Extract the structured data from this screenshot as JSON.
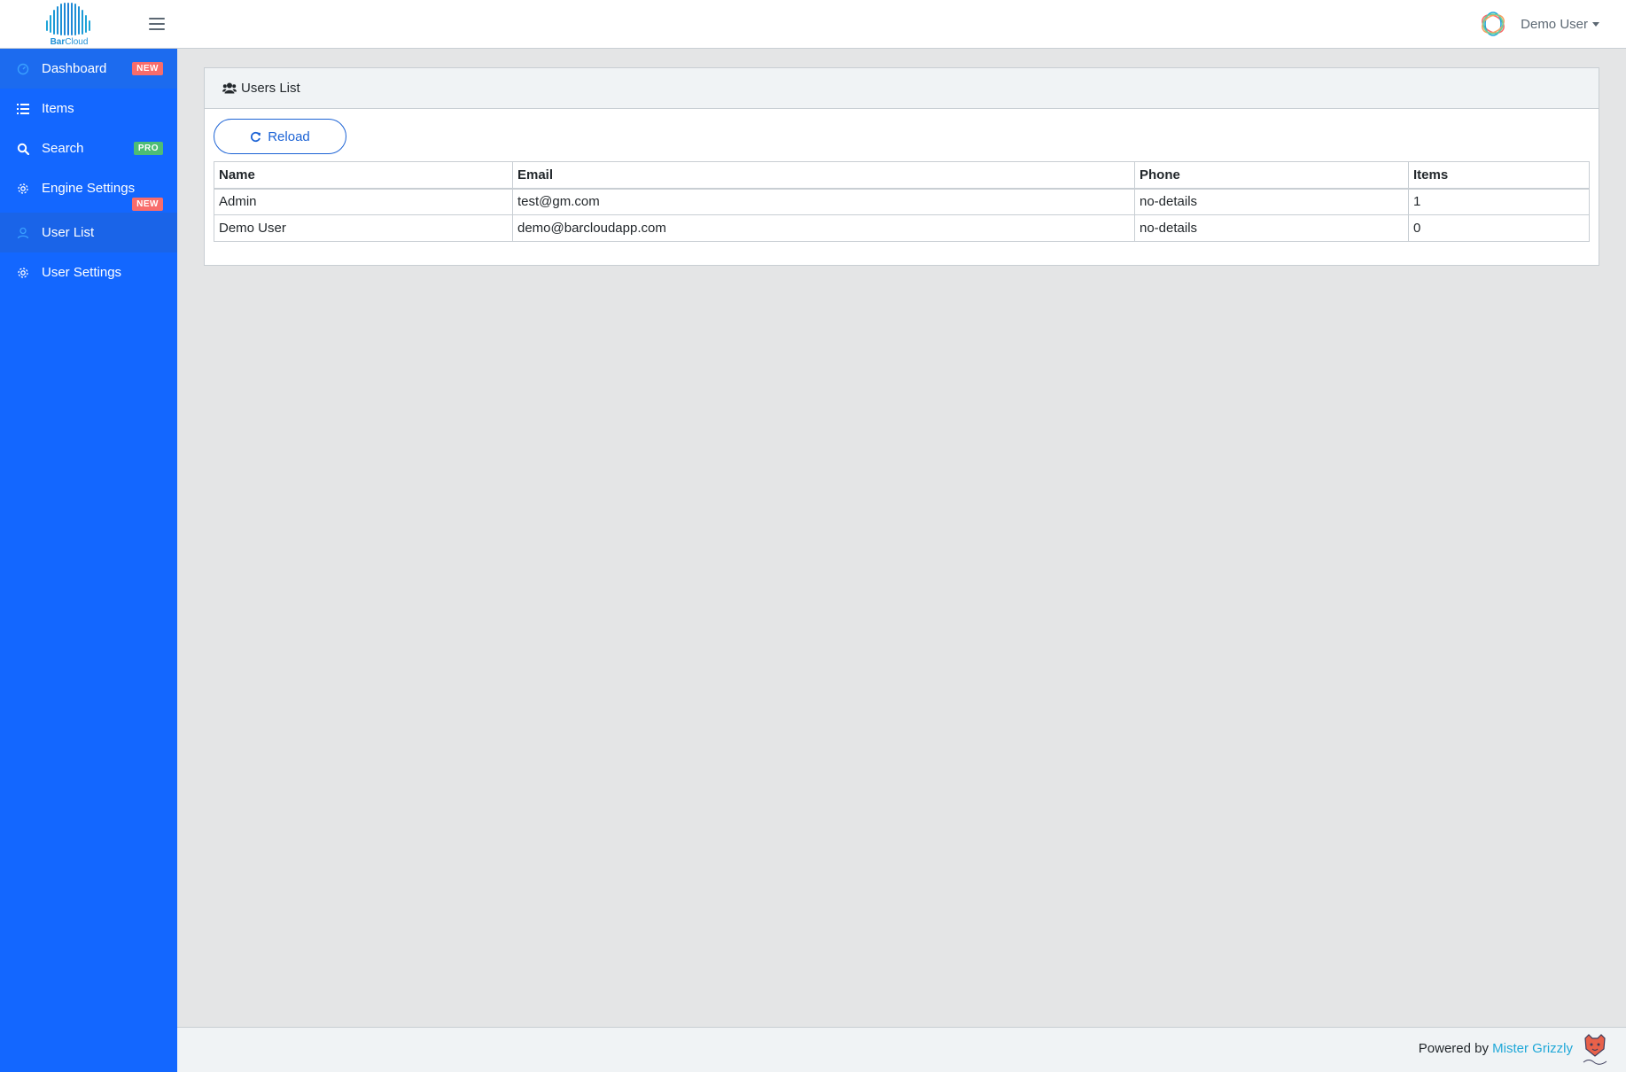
{
  "brand": {
    "name_bold": "Bar",
    "name_light": "Cloud",
    "accent": "#1e90d6"
  },
  "header": {
    "user_name": "Demo User"
  },
  "sidebar": {
    "background": "#1367ff",
    "items": [
      {
        "label": "Dashboard",
        "icon": "speedometer-icon",
        "badge": "NEW"
      },
      {
        "label": "Items",
        "icon": "list-icon",
        "badge": ""
      },
      {
        "label": "Search",
        "icon": "search-icon",
        "badge": "PRO"
      },
      {
        "label": "Engine Settings",
        "icon": "gear-icon",
        "badge": "NEW"
      },
      {
        "label": "User List",
        "icon": "user-icon",
        "badge": ""
      },
      {
        "label": "User Settings",
        "icon": "gear-icon",
        "badge": ""
      }
    ]
  },
  "main": {
    "card_title": "Users List",
    "reload_label": "Reload",
    "table": {
      "headers": [
        "Name",
        "Email",
        "Phone",
        "Items"
      ],
      "rows": [
        [
          "Admin",
          "test@gm.com",
          "no-details",
          "1"
        ],
        [
          "Demo User",
          "demo@barcloudapp.com",
          "no-details",
          "0"
        ]
      ]
    }
  },
  "footer": {
    "prefix": "Powered by",
    "link_text": "Mister Grizzly"
  }
}
